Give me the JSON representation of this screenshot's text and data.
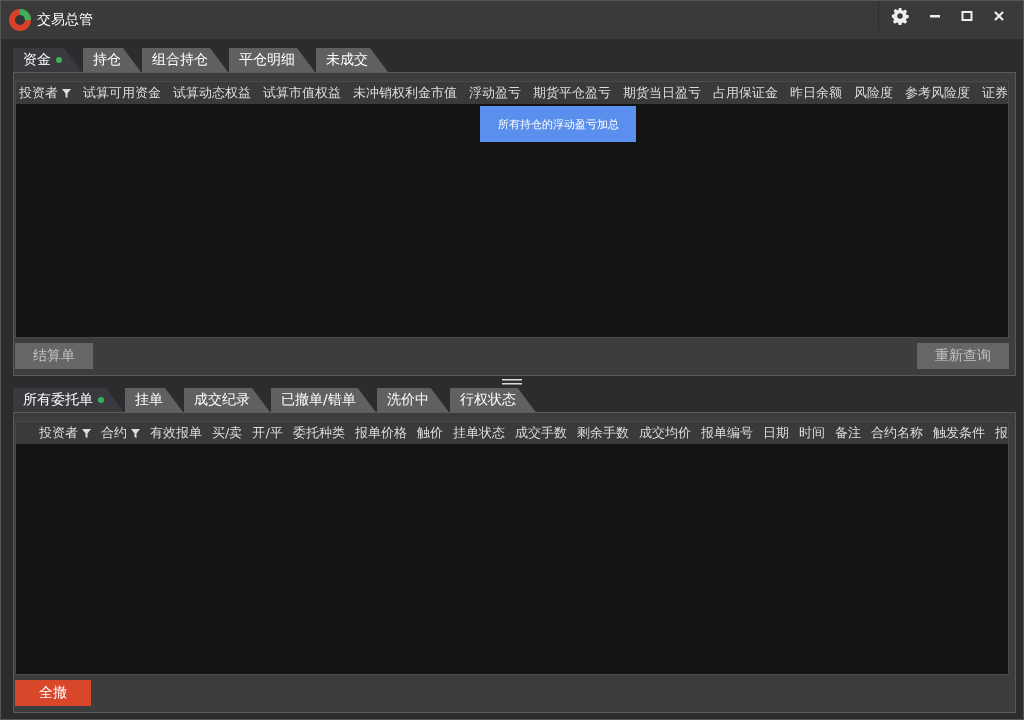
{
  "window": {
    "title": "交易总管"
  },
  "top_panel": {
    "tabs": [
      {
        "label": "资金",
        "selected": true,
        "indicator": true
      },
      {
        "label": "持仓",
        "selected": false,
        "indicator": false
      },
      {
        "label": "组合持仓",
        "selected": false,
        "indicator": false
      },
      {
        "label": "平仓明细",
        "selected": false,
        "indicator": false
      },
      {
        "label": "未成交",
        "selected": false,
        "indicator": false
      }
    ],
    "columns": [
      {
        "label": "投资者",
        "filter": true
      },
      {
        "label": "试算可用资金",
        "filter": false
      },
      {
        "label": "试算动态权益",
        "filter": false
      },
      {
        "label": "试算市值权益",
        "filter": false
      },
      {
        "label": "未冲销权利金市值",
        "filter": false
      },
      {
        "label": "浮动盈亏",
        "filter": false
      },
      {
        "label": "期货平仓盈亏",
        "filter": false
      },
      {
        "label": "期货当日盈亏",
        "filter": false
      },
      {
        "label": "占用保证金",
        "filter": false
      },
      {
        "label": "昨日余额",
        "filter": false
      },
      {
        "label": "风险度",
        "filter": false
      },
      {
        "label": "参考风险度",
        "filter": false
      },
      {
        "label": "证券",
        "filter": false
      }
    ],
    "tooltip": "所有持仓的浮动盈亏加总",
    "buttons": [
      {
        "label": "结算单",
        "kind": "plain",
        "disabled": true
      },
      {
        "label": "重新查询",
        "kind": "plain",
        "disabled": true
      }
    ]
  },
  "bottom_panel": {
    "tabs": [
      {
        "label": "所有委托单",
        "selected": true,
        "indicator": true
      },
      {
        "label": "挂单",
        "selected": false,
        "indicator": false
      },
      {
        "label": "成交纪录",
        "selected": false,
        "indicator": false
      },
      {
        "label": "已撤单/错单",
        "selected": false,
        "indicator": false
      },
      {
        "label": "洗价中",
        "selected": false,
        "indicator": false
      },
      {
        "label": "行权状态",
        "selected": false,
        "indicator": false
      }
    ],
    "columns": [
      {
        "label": "投资者",
        "filter": true
      },
      {
        "label": "合约",
        "filter": true
      },
      {
        "label": "有效报单",
        "filter": false
      },
      {
        "label": "买/卖",
        "filter": false
      },
      {
        "label": "开/平",
        "filter": false
      },
      {
        "label": "委托种类",
        "filter": false
      },
      {
        "label": "报单价格",
        "filter": false
      },
      {
        "label": "触价",
        "filter": false
      },
      {
        "label": "挂单状态",
        "filter": false
      },
      {
        "label": "成交手数",
        "filter": false
      },
      {
        "label": "剩余手数",
        "filter": false
      },
      {
        "label": "成交均价",
        "filter": false
      },
      {
        "label": "报单编号",
        "filter": false
      },
      {
        "label": "日期",
        "filter": false
      },
      {
        "label": "时间",
        "filter": false
      },
      {
        "label": "备注",
        "filter": false
      },
      {
        "label": "合约名称",
        "filter": false
      },
      {
        "label": "触发条件",
        "filter": false
      },
      {
        "label": "报",
        "filter": false
      }
    ],
    "buttons": [
      {
        "label": "全撤",
        "kind": "danger",
        "disabled": false
      }
    ]
  }
}
